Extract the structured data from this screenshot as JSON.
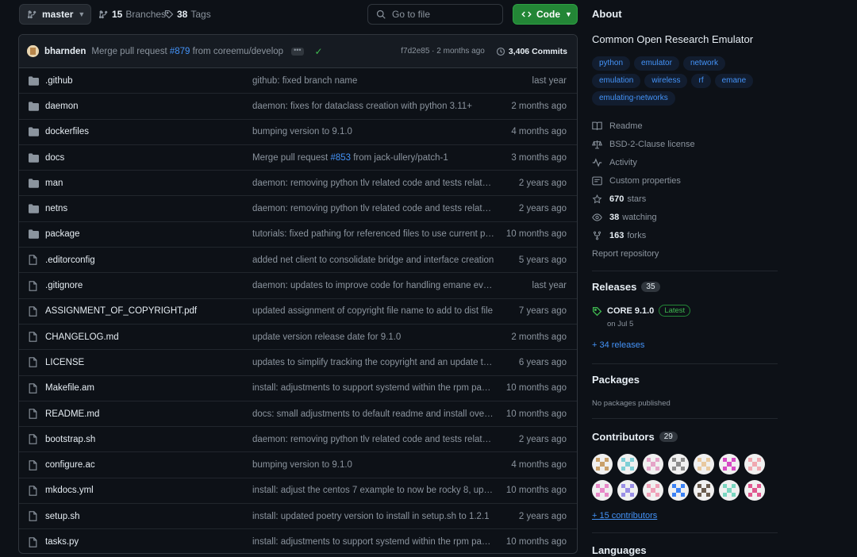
{
  "colors": {
    "accent_link": "#4493f8",
    "success": "#3fb950",
    "code_button": "#238636",
    "bg": "#0d1117",
    "panel": "#161b22",
    "border": "#30363d"
  },
  "toolbar": {
    "branch": "master",
    "branches_count": "15",
    "branches_label": "Branches",
    "tags_count": "38",
    "tags_label": "Tags",
    "goto_placeholder": "Go to file",
    "code_label": "Code"
  },
  "commit": {
    "author": "bharnden",
    "message_before": "Merge pull request ",
    "pr": "#879",
    "message_after": " from coreemu/develop",
    "dots": "•••",
    "check": "✓",
    "hash_time": "f7d2e85 · 2 months ago",
    "commits": "3,406 Commits"
  },
  "files": [
    {
      "type": "dir",
      "name": ".github",
      "message": "github: fixed branch name",
      "date": "last year"
    },
    {
      "type": "dir",
      "name": "daemon",
      "message": "daemon: fixes for dataclass creation with python 3.11+",
      "date": "2 months ago"
    },
    {
      "type": "dir",
      "name": "dockerfiles",
      "message": "bumping version to 9.1.0",
      "date": "4 months ago"
    },
    {
      "type": "dir",
      "name": "docs",
      "message": "Merge pull request ",
      "pr": "#853",
      "message_after": " from jack-ullery/patch-1",
      "date": "3 months ago"
    },
    {
      "type": "dir",
      "name": "man",
      "message": "daemon: removing python tlv related code and tests related ...",
      "date": "2 years ago"
    },
    {
      "type": "dir",
      "name": "netns",
      "message": "daemon: removing python tlv related code and tests related ...",
      "date": "2 years ago"
    },
    {
      "type": "dir",
      "name": "package",
      "message": "tutorials: fixed pathing for referenced files to use current pat...",
      "date": "10 months ago"
    },
    {
      "type": "file",
      "name": ".editorconfig",
      "message": "added net client to consolidate bridge and interface creation",
      "date": "5 years ago"
    },
    {
      "type": "file",
      "name": ".gitignore",
      "message": "daemon: updates to improve code for handling emane even...",
      "date": "last year"
    },
    {
      "type": "file",
      "name": "ASSIGNMENT_OF_COPYRIGHT.pdf",
      "message": "updated assignment of copyright file name to add to dist file",
      "date": "7 years ago"
    },
    {
      "type": "file",
      "name": "CHANGELOG.md",
      "message": "update version release date for 9.1.0",
      "date": "2 months ago"
    },
    {
      "type": "file",
      "name": "LICENSE",
      "message": "updates to simplify tracking the copyright and an update to ...",
      "date": "6 years ago"
    },
    {
      "type": "file",
      "name": "Makefile.am",
      "message": "install: adjustments to support systemd within the rpm pack...",
      "date": "10 months ago"
    },
    {
      "type": "file",
      "name": "README.md",
      "message": "docs: small adjustments to default readme and install overvi...",
      "date": "10 months ago"
    },
    {
      "type": "file",
      "name": "bootstrap.sh",
      "message": "daemon: removing python tlv related code and tests related ...",
      "date": "2 years ago"
    },
    {
      "type": "file",
      "name": "configure.ac",
      "message": "bumping version to 9.1.0",
      "date": "4 months ago"
    },
    {
      "type": "file",
      "name": "mkdocs.yml",
      "message": "install: adjust the centos 7 example to now be rocky 8, updat...",
      "date": "10 months ago"
    },
    {
      "type": "file",
      "name": "setup.sh",
      "message": "install: updated poetry version to install in setup.sh to 1.2.1",
      "date": "2 years ago"
    },
    {
      "type": "file",
      "name": "tasks.py",
      "message": "install: adjustments to support systemd within the rpm pack...",
      "date": "10 months ago"
    }
  ],
  "about": {
    "title": "About",
    "description": "Common Open Research Emulator",
    "topics": [
      "python",
      "emulator",
      "network",
      "emulation",
      "wireless",
      "rf",
      "emane",
      "emulating-networks"
    ],
    "meta": [
      {
        "icon": "book-icon",
        "label": "Readme"
      },
      {
        "icon": "law-icon",
        "label": "BSD-2-Clause license"
      },
      {
        "icon": "pulse-icon",
        "label": "Activity"
      },
      {
        "icon": "note-icon",
        "label": "Custom properties"
      },
      {
        "icon": "star-icon",
        "count": "670",
        "label": "stars"
      },
      {
        "icon": "eye-icon",
        "count": "38",
        "label": "watching"
      },
      {
        "icon": "fork-icon",
        "count": "163",
        "label": "forks"
      },
      {
        "icon": "",
        "label": "Report repository"
      }
    ]
  },
  "releases": {
    "title": "Releases",
    "count": "35",
    "latest_name": "CORE 9.1.0",
    "latest_badge": "Latest",
    "latest_date": "on Jul 5",
    "more": "+ 34 releases"
  },
  "packages": {
    "title": "Packages",
    "empty": "No packages published"
  },
  "contributors": {
    "title": "Contributors",
    "count": "29",
    "more": "+ 15 contributors",
    "avatars": [
      "#c9a06a",
      "#7ecfd6",
      "#e5a4c8",
      "#8d8d8d",
      "#e8c9a0",
      "#d64bc4",
      "#f0a8b0",
      "#e889c8",
      "#9a8fe6",
      "#f0a0b8",
      "#3b82f6",
      "#6b5d4f",
      "#7ad6c0",
      "#e0588f"
    ]
  },
  "languages": {
    "title": "Languages"
  }
}
